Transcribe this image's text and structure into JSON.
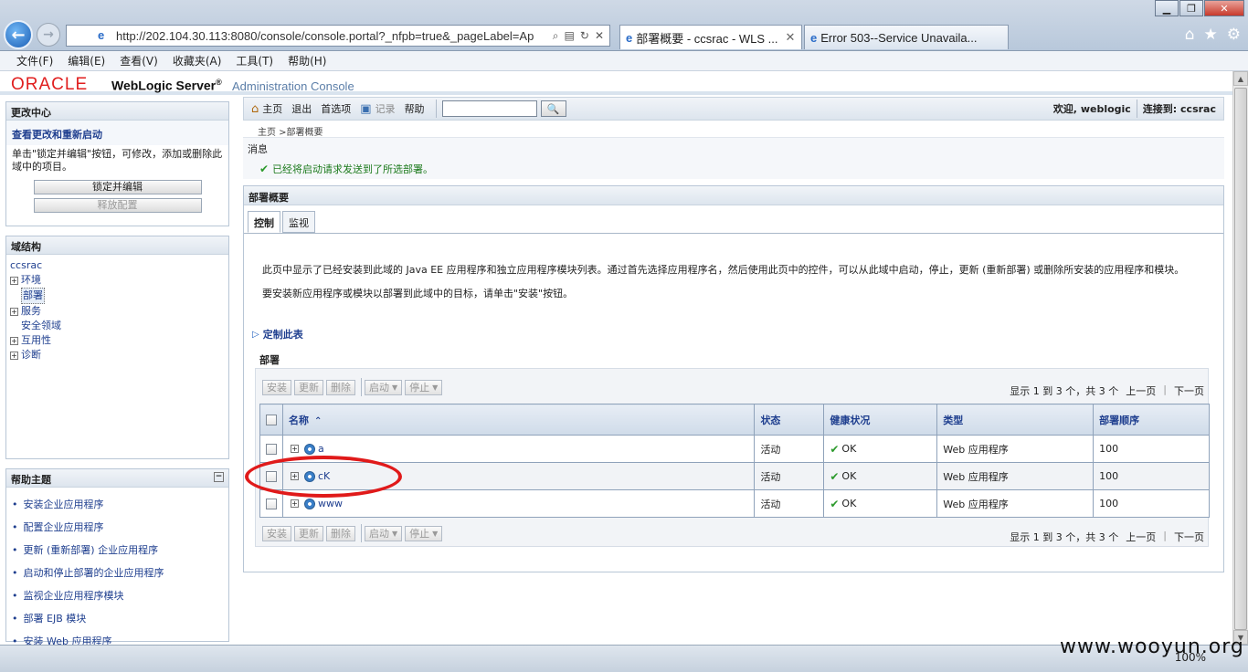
{
  "browser": {
    "url": "http://202.104.30.113:8080/console/console.portal?_nfpb=true&_pageLabel=Ap",
    "tabs": [
      {
        "label": "部署概要 - ccsrac - WLS ..."
      },
      {
        "label": "Error 503--Service Unavaila..."
      }
    ],
    "menu": [
      "文件(F)",
      "编辑(E)",
      "查看(V)",
      "收藏夹(A)",
      "工具(T)",
      "帮助(H)"
    ],
    "zoom": "100%"
  },
  "header": {
    "logo": "ORACLE",
    "product": "WebLogic Server",
    "reg": "®",
    "console": "Administration Console"
  },
  "change_center": {
    "title": "更改中心",
    "link": "查看更改和重新启动",
    "desc": "单击\"锁定并编辑\"按钮，可修改，添加或删除此域中的项目。",
    "lock_button": "锁定并编辑",
    "release_button": "释放配置"
  },
  "domain_structure": {
    "title": "域结构",
    "root": "ccsrac",
    "items": [
      {
        "label": "环境",
        "expandable": true
      },
      {
        "label": "部署",
        "expandable": false,
        "selected": true
      },
      {
        "label": "服务",
        "expandable": true
      },
      {
        "label": "安全领域",
        "expandable": false
      },
      {
        "label": "互用性",
        "expandable": true
      },
      {
        "label": "诊断",
        "expandable": true
      }
    ]
  },
  "help_topics": {
    "title": "帮助主题",
    "items": [
      "安装企业应用程序",
      "配置企业应用程序",
      "更新 (重新部署) 企业应用程序",
      "启动和停止部署的企业应用程序",
      "监视企业应用程序模块",
      "部署 EJB 模块",
      "安装 Web 应用程序"
    ]
  },
  "toolbar": {
    "home": "主页",
    "logout": "退出",
    "prefs": "首选项",
    "record": "记录",
    "help": "帮助",
    "welcome": "欢迎, weblogic",
    "connected": "连接到: ccsrac"
  },
  "breadcrumb": "主页 >部署概要",
  "messages": {
    "title": "消息",
    "text": "已经将启动请求发送到了所选部署。"
  },
  "main": {
    "title": "部署概要",
    "tabs": [
      "控制",
      "监视"
    ],
    "desc1": "此页中显示了已经安装到此域的 Java EE 应用程序和独立应用程序模块列表。通过首先选择应用程序名，然后使用此页中的控件，可以从此域中启动，停止，更新 (重新部署) 或删除所安装的应用程序和模块。",
    "desc2": "要安装新应用程序或模块以部署到此域中的目标，请单击\"安装\"按钮。",
    "customize": "定制此表",
    "section": "部署",
    "buttons": {
      "install": "安装",
      "update": "更新",
      "delete": "删除",
      "start": "启动",
      "stop": "停止"
    },
    "pager": {
      "summary": "显示 1 到 3 个，共 3 个",
      "prev": "上一页",
      "next": "下一页"
    },
    "columns": [
      "名称",
      "状态",
      "健康状况",
      "类型",
      "部署顺序"
    ],
    "rows": [
      {
        "name": "a",
        "state": "活动",
        "health": "OK",
        "type": "Web 应用程序",
        "order": "100"
      },
      {
        "name": "cK",
        "state": "活动",
        "health": "OK",
        "type": "Web 应用程序",
        "order": "100"
      },
      {
        "name": "www",
        "state": "活动",
        "health": "OK",
        "type": "Web 应用程序",
        "order": "100"
      }
    ]
  },
  "watermark": "www.wooyun.org"
}
